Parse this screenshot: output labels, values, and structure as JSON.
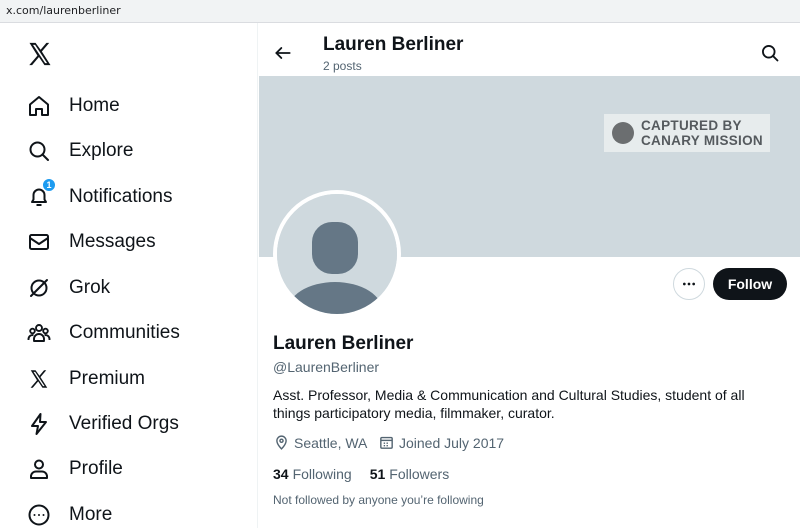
{
  "browser": {
    "url": "x.com/laurenberliner"
  },
  "sidebar": {
    "items": [
      {
        "label": "Home",
        "icon": "home-icon"
      },
      {
        "label": "Explore",
        "icon": "search-icon"
      },
      {
        "label": "Notifications",
        "icon": "bell-icon",
        "badge": "1"
      },
      {
        "label": "Messages",
        "icon": "envelope-icon"
      },
      {
        "label": "Grok",
        "icon": "grok-icon"
      },
      {
        "label": "Communities",
        "icon": "people-icon"
      },
      {
        "label": "Premium",
        "icon": "x-logo-icon"
      },
      {
        "label": "Verified Orgs",
        "icon": "lightning-icon"
      },
      {
        "label": "Profile",
        "icon": "person-icon"
      },
      {
        "label": "More",
        "icon": "more-circle-icon"
      }
    ]
  },
  "header": {
    "name": "Lauren Berliner",
    "posts": "2 posts"
  },
  "banner": {
    "watermark_line1": "CAPTURED BY",
    "watermark_line2": "CANARY MISSION"
  },
  "profile": {
    "name": "Lauren Berliner",
    "handle": "@LaurenBerliner",
    "bio": "Asst. Professor, Media & Communication and Cultural Studies, student of all things participatory media, filmmaker, curator.",
    "location": "Seattle, WA",
    "joined": "Joined July 2017",
    "following_count": "34",
    "following_label": "Following",
    "followers_count": "51",
    "followers_label": "Followers",
    "not_followed": "Not followed by anyone you’re following"
  },
  "actions": {
    "follow_label": "Follow"
  },
  "colors": {
    "accent": "#1d9bf0",
    "banner": "#cfd9de",
    "text": "#0f1419",
    "muted": "#536471"
  }
}
